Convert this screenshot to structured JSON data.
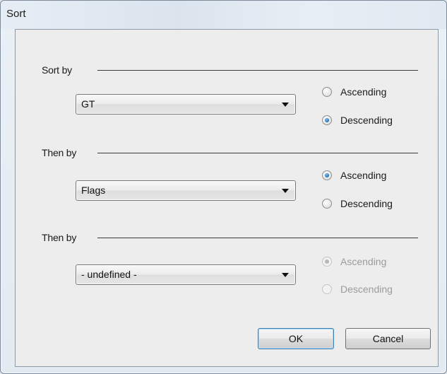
{
  "window": {
    "title": "Sort"
  },
  "groups": [
    {
      "label": "Sort by",
      "combo_value": "GT",
      "ascending": {
        "label": "Ascending",
        "checked": false,
        "enabled": true
      },
      "descending": {
        "label": "Descending",
        "checked": true,
        "enabled": true
      }
    },
    {
      "label": "Then by",
      "combo_value": "Flags",
      "ascending": {
        "label": "Ascending",
        "checked": true,
        "enabled": true
      },
      "descending": {
        "label": "Descending",
        "checked": false,
        "enabled": true
      }
    },
    {
      "label": "Then by",
      "combo_value": "- undefined -",
      "ascending": {
        "label": "Ascending",
        "checked": true,
        "enabled": false
      },
      "descending": {
        "label": "Descending",
        "checked": false,
        "enabled": false
      }
    }
  ],
  "buttons": {
    "ok": "OK",
    "cancel": "Cancel"
  }
}
